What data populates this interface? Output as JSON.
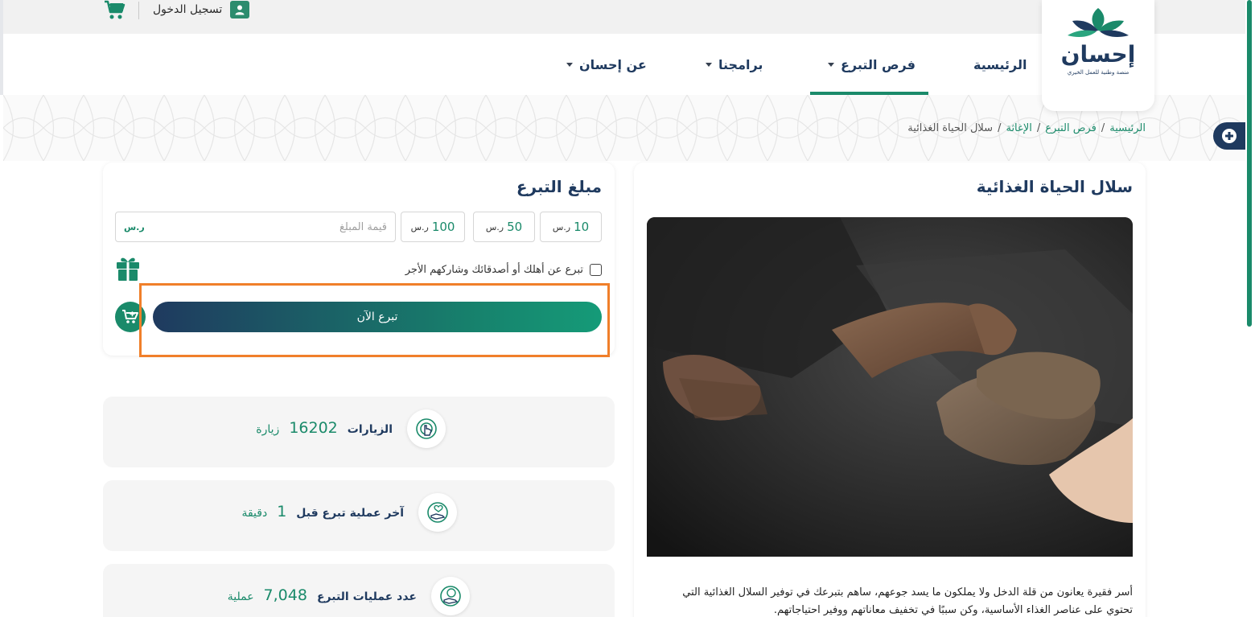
{
  "header": {
    "login_label": "تسجيل الدخول",
    "cart_icon": "cart-icon",
    "user_icon": "user-icon"
  },
  "logo": {
    "name": "إحسان",
    "tagline": "منصة وطنية للعمل الخيري"
  },
  "nav": {
    "items": [
      {
        "label": "الرئيسية",
        "has_dropdown": false
      },
      {
        "label": "فرص التبرع",
        "has_dropdown": true,
        "active": true
      },
      {
        "label": "برامجنا",
        "has_dropdown": true
      },
      {
        "label": "عن إحسان",
        "has_dropdown": true
      }
    ]
  },
  "breadcrumb": {
    "home": "الرئيسية",
    "sep1": "/",
    "opportunities": "فرص التبرع",
    "sep2": "/",
    "relief": "الإغاثة",
    "sep3": "/",
    "current": "سلال الحياة الغذائية"
  },
  "project": {
    "title": "سلال الحياة الغذائية",
    "description": "أسر فقيرة يعانون من قلة الدخل ولا يملكون ما يسد جوعهم، ساهم بتبرعك في توفير السلال الغذائية التي تحتوي على عناصر الغذاء الأساسية، وكن سببًا في تخفيف معاناتهم ووفير احتياجاتهم."
  },
  "donation": {
    "title": "مبلغ التبرع",
    "presets": [
      {
        "value": "10",
        "currency": "ر.س"
      },
      {
        "value": "50",
        "currency": "ر.س"
      },
      {
        "value": "100",
        "currency": "ر.س"
      }
    ],
    "input_placeholder": "قيمة المبلغ",
    "input_currency": "ر.س",
    "gift_label": "تبرع عن أهلك أو أصدقائك وشاركهم الأجر",
    "donate_now": "تبرع الآن"
  },
  "stats": [
    {
      "label": "الزيارات",
      "value": "16202",
      "unit": "زيارة"
    },
    {
      "label": "آخر عملية تبرع قبل",
      "value": "1",
      "unit": "دقيقة"
    },
    {
      "label": "عدد عمليات التبرع",
      "value": "7,048",
      "unit": "عملية"
    }
  ],
  "colors": {
    "primary_navy": "#1f3a5f",
    "primary_green": "#1a8a6a",
    "highlight_orange": "#f07f2a"
  }
}
